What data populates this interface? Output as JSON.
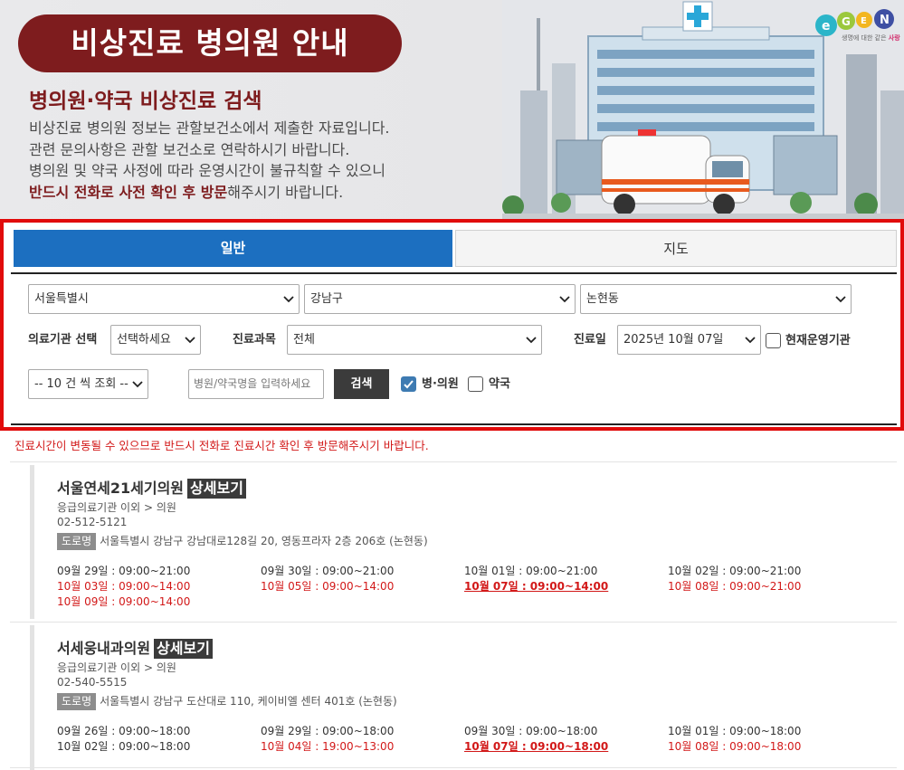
{
  "banner": {
    "title": "비상진료 병의원 안내",
    "subtitle": "병의원·약국 비상진료 검색",
    "desc_lines": [
      "비상진료 병의원 정보는 관할보건소에서 제출한 자료입니다.",
      "관련 문의사항은 관할 보건소로 연락하시기 바랍니다.",
      "병의원 및 약국 사정에 따라 운영시간이 불규칙할 수 있으니"
    ],
    "desc_last_strong": "반드시 전화로 사전 확인 후 방문",
    "desc_last_rest": "해주시기 바랍니다.",
    "logo_text": "e-GEN",
    "logo_tag_a": "생명에 대한 같은 ",
    "logo_tag_b": "사랑"
  },
  "tabs": {
    "general": "일반",
    "map": "지도"
  },
  "filters": {
    "sido": "서울특별시",
    "sigungu": "강남구",
    "dong": "논현동",
    "inst_label": "의료기관 선택",
    "inst_value": "선택하세요",
    "dept_label": "진료과목",
    "dept_value": "전체",
    "date_label": "진료일",
    "date_value": "2025년 10월 07일",
    "open_now_label": "현재운영기관",
    "page_size": "-- 10 건 씩 조회 --",
    "name_placeholder": "병원/약국명을 입력하세요",
    "search_button": "검색",
    "hospital_label": "병·의원",
    "pharmacy_label": "약국"
  },
  "notice": "진료시간이 변동될 수 있으므로 반드시 전화로 진료시간 확인 후 방문해주시기 바랍니다.",
  "results": [
    {
      "name": "서울연세21세기의원",
      "detail": "상세보기",
      "type": "응급의료기관 이외 > 의원",
      "phone": "02-512-5121",
      "road": "도로명",
      "address": "서울특별시 강남구 강남대로128길 20, 영동프라자 2층 206호 (논현동)",
      "schedule": [
        {
          "text": "09월 29일 : 09:00~21:00",
          "style": "normal"
        },
        {
          "text": "09월 30일 : 09:00~21:00",
          "style": "normal"
        },
        {
          "text": "10월 01일 : 09:00~21:00",
          "style": "normal"
        },
        {
          "text": "10월 02일 : 09:00~21:00",
          "style": "normal"
        },
        {
          "text": "10월 03일 : 09:00~14:00",
          "style": "red"
        },
        {
          "text": "10월 05일 : 09:00~14:00",
          "style": "red"
        },
        {
          "text": "10월 07일 : 09:00~14:00",
          "style": "today"
        },
        {
          "text": "10월 08일 : 09:00~21:00",
          "style": "red"
        },
        {
          "text": "10월 09일 : 09:00~14:00",
          "style": "red"
        }
      ]
    },
    {
      "name": "서세웅내과의원",
      "detail": "상세보기",
      "type": "응급의료기관 이외 > 의원",
      "phone": "02-540-5515",
      "road": "도로명",
      "address": "서울특별시 강남구 도산대로 110, 케이비엘 센터 401호 (논현동)",
      "schedule": [
        {
          "text": "09월 26일 : 09:00~18:00",
          "style": "normal"
        },
        {
          "text": "09월 29일 : 09:00~18:00",
          "style": "normal"
        },
        {
          "text": "09월 30일 : 09:00~18:00",
          "style": "normal"
        },
        {
          "text": "10월 01일 : 09:00~18:00",
          "style": "normal"
        },
        {
          "text": "10월 02일 : 09:00~18:00",
          "style": "normal"
        },
        {
          "text": "10월 04일 : 19:00~13:00",
          "style": "red"
        },
        {
          "text": "10월 07일 : 09:00~18:00",
          "style": "today"
        },
        {
          "text": "10월 08일 : 09:00~18:00",
          "style": "red"
        }
      ]
    }
  ],
  "colors": {
    "brand": "#7e1c1e",
    "tab_active": "#1c6fc0",
    "highlight_border": "#e10b0b",
    "warning": "#d21818"
  }
}
